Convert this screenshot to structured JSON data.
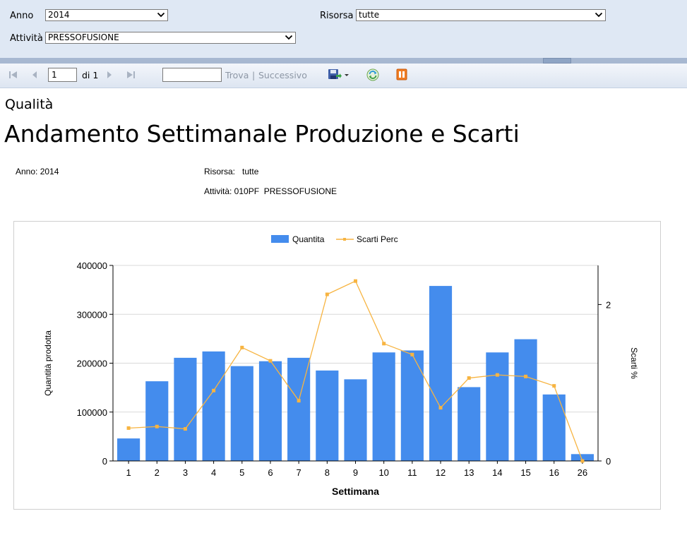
{
  "params": {
    "anno_label": "Anno",
    "anno_value": "2014",
    "risorsa_label": "Risorsa",
    "risorsa_value": "tutte",
    "attivita_label": "Attività",
    "attivita_value": "PRESSOFUSIONE"
  },
  "toolbar": {
    "page_value": "1",
    "page_of": "di 1",
    "find_value": "",
    "find_label": "Trova",
    "separator": "|",
    "next_label": "Successivo",
    "icons": [
      "first-page-icon",
      "previous-page-icon",
      "next-page-icon",
      "last-page-icon",
      "export-icon",
      "refresh-icon",
      "print-layout-icon"
    ]
  },
  "report": {
    "subtitle": "Qualità",
    "title": "Andamento Settimanale Produzione e Scarti",
    "anno": "Anno: 2014",
    "risorsa": "Risorsa:   tutte",
    "attivita": "Attività: 010PF  PRESSOFUSIONE"
  },
  "chart_data": {
    "type": "bar",
    "title": "",
    "xlabel": "Settimana",
    "ylabel": "Quantità prodotta",
    "y2label": "Scarti %",
    "categories": [
      "1",
      "2",
      "3",
      "4",
      "5",
      "6",
      "7",
      "8",
      "9",
      "10",
      "11",
      "12",
      "13",
      "14",
      "15",
      "16",
      "26"
    ],
    "ylim": [
      0,
      400000
    ],
    "yticks": [
      0,
      100000,
      200000,
      300000,
      400000
    ],
    "y2lim": [
      0,
      2.5
    ],
    "y2ticks": [
      0,
      2
    ],
    "legend_position": "top-center",
    "grid": true,
    "series": [
      {
        "name": "Quantita",
        "type": "bar",
        "axis": "left",
        "color": "#448ced",
        "values": [
          46000,
          163000,
          211000,
          224000,
          194000,
          204000,
          211000,
          185000,
          167000,
          222000,
          226000,
          358000,
          151000,
          222000,
          249000,
          136000,
          14000
        ]
      },
      {
        "name": "Scarti Perc",
        "type": "line",
        "axis": "right",
        "color": "#f7b441",
        "values": [
          0.42,
          0.44,
          0.41,
          0.9,
          1.45,
          1.28,
          0.77,
          2.13,
          2.3,
          1.5,
          1.36,
          0.68,
          1.06,
          1.1,
          1.08,
          0.96,
          0.0
        ]
      }
    ]
  }
}
